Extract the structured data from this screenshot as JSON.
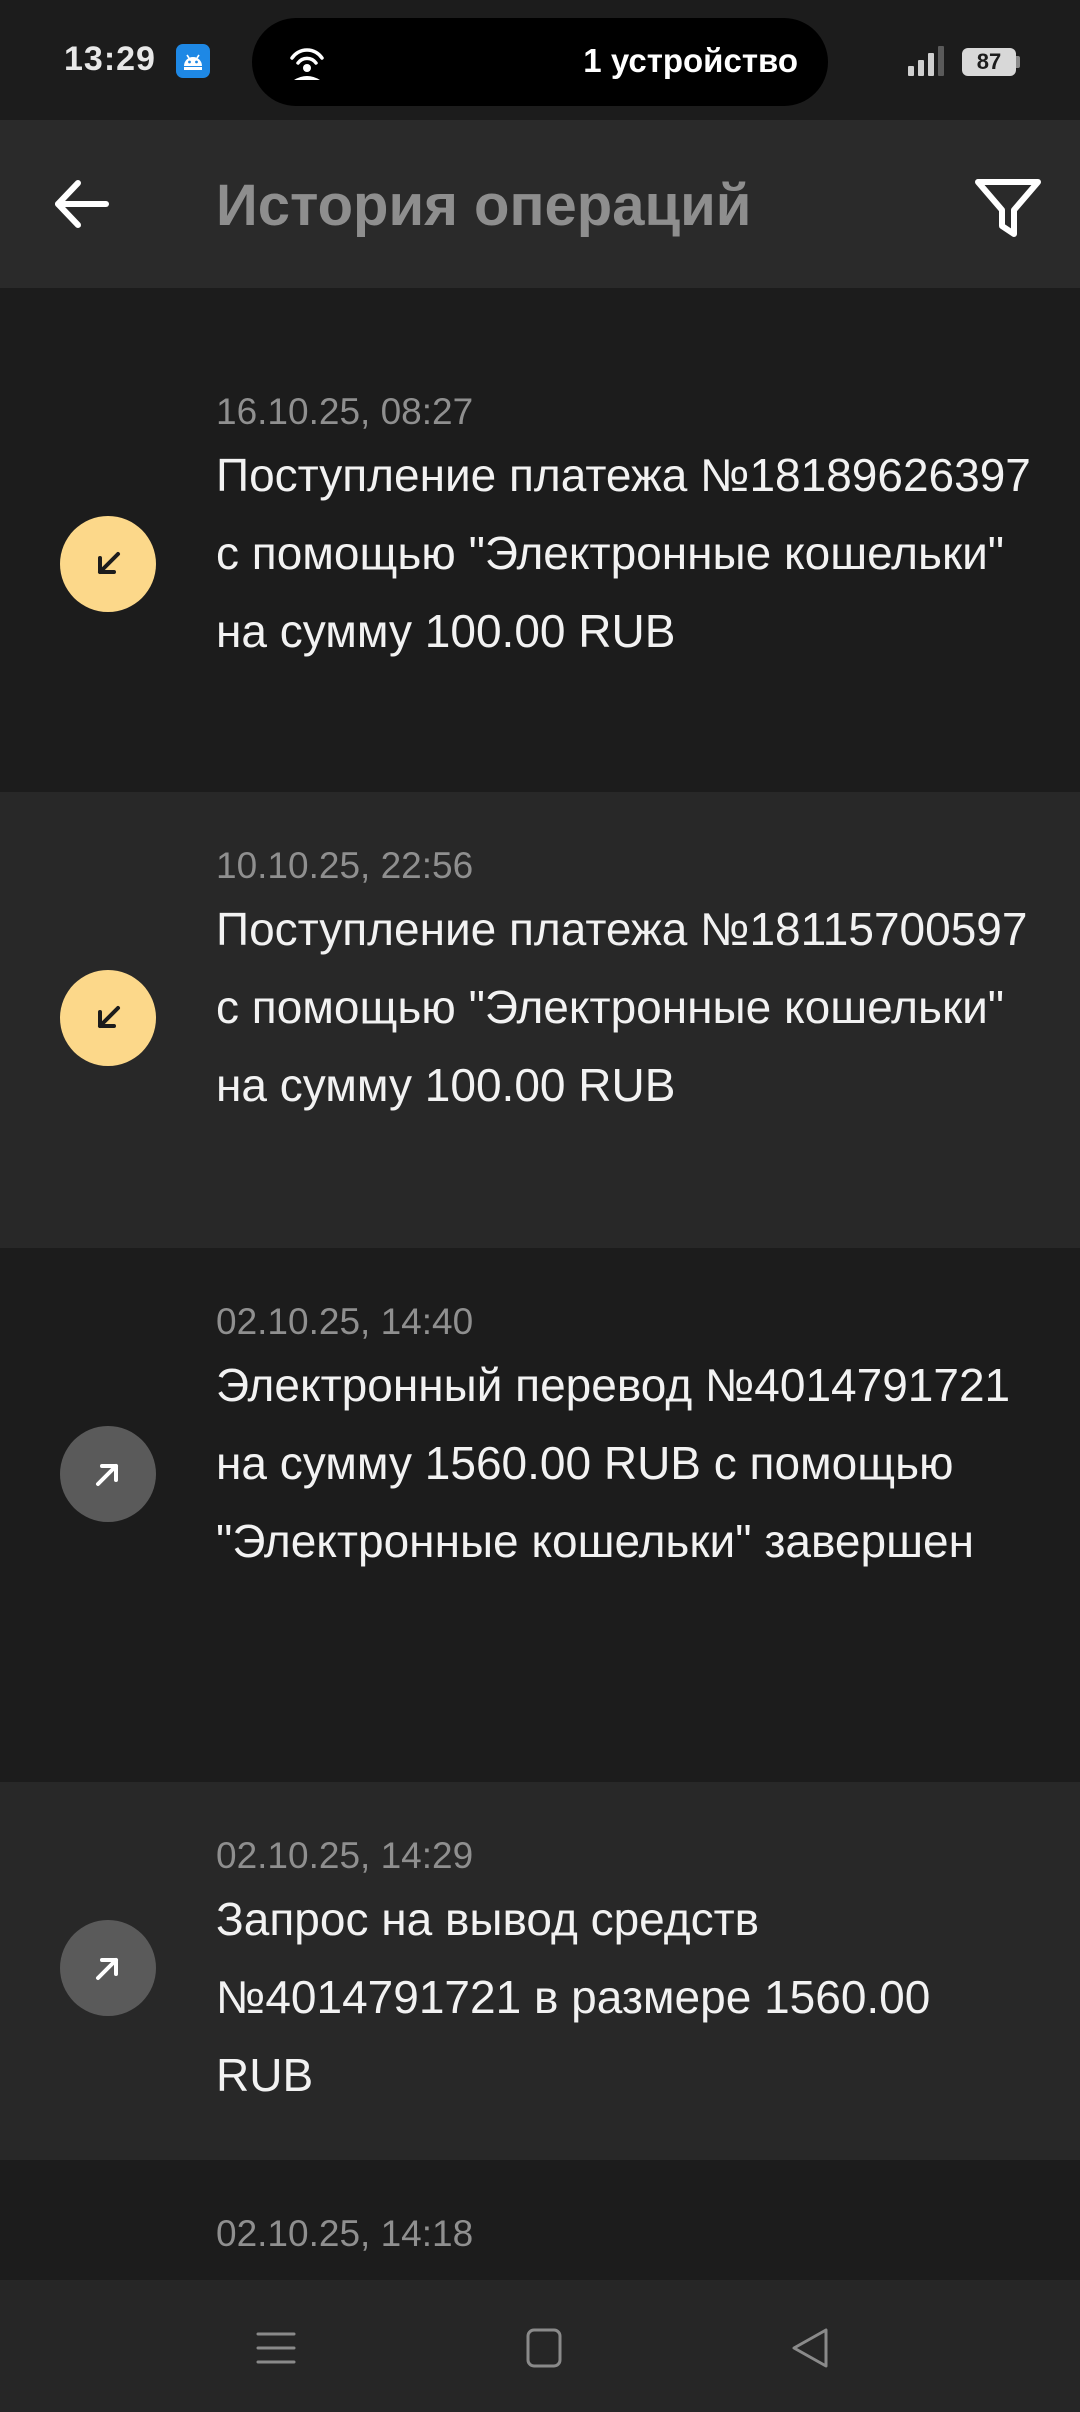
{
  "status_bar": {
    "time": "13:29",
    "pill_text": "1 устройство",
    "battery": "87"
  },
  "header": {
    "title": "История операций"
  },
  "operations": [
    {
      "date": "16.10.25, 08:27",
      "text": "Поступление платежа №18189626397 с помощью \"Электронные кошельки\" на сумму 100.00 RUB",
      "direction": "incoming"
    },
    {
      "date": "10.10.25, 22:56",
      "text": "Поступление платежа №18115700597 с помощью \"Электронные кошельки\" на сумму 100.00 RUB",
      "direction": "incoming"
    },
    {
      "date": "02.10.25, 14:40",
      "text": "Электронный перевод №4014791721 на сумму 1560.00 RUB с помощью \"Электронные кошельки\" завершен",
      "direction": "outgoing"
    },
    {
      "date": "02.10.25, 14:29",
      "text": "Запрос на вывод средств №4014791721 в размере 1560.00 RUB",
      "direction": "outgoing"
    },
    {
      "date": "02.10.25, 14:18",
      "text": "",
      "direction": "unknown"
    }
  ],
  "icons": {
    "back": "arrow-left-icon",
    "filter": "filter-funnel-icon",
    "incoming": "arrow-down-left-icon",
    "outgoing": "arrow-up-right-icon",
    "nav_menu": "menu-icon",
    "nav_home": "square-icon",
    "nav_back": "triangle-back-icon"
  },
  "colors": {
    "background": "#1c1c1c",
    "header": "#2a2a2a",
    "incoming_badge": "#fcd88a",
    "outgoing_badge": "#5a5a5a",
    "android_badge": "#1e88e5"
  }
}
